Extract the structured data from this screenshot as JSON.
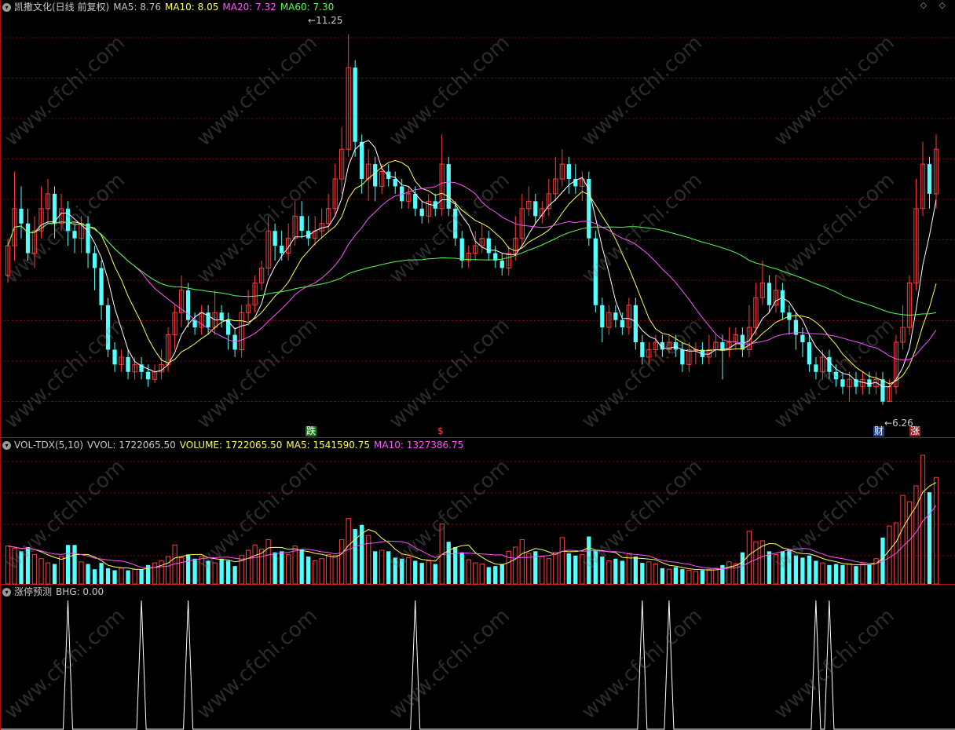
{
  "header": {
    "title": "凯撒文化(日线 前复权)",
    "ma5": "MA5: 8.76",
    "ma10": "MA10: 8.05",
    "ma20": "MA20: 7.32",
    "ma60": "MA60: 7.30",
    "corner_icons": "◇ ◇"
  },
  "colors": {
    "up": "#ff3c3c",
    "down": "#54ffff",
    "ma5": "#ffffff",
    "ma10": "#ffff54",
    "ma20": "#ff54ff",
    "ma60": "#54ff54",
    "grid": "#8b0000"
  },
  "annotations": {
    "high": "11.25",
    "low": "6.26",
    "tag_die": "跌",
    "tag_s": "$",
    "tag_cai": "财",
    "tag_zhang": "涨"
  },
  "volume_header": {
    "name": "VOL-TDX(5,10)",
    "vvol": "VVOL: 1722065.50",
    "volume": "VOLUME: 1722065.50",
    "ma5": "MA5: 1541590.75",
    "ma10": "MA10: 1327386.75"
  },
  "indicator_header": {
    "name": "涨停预测",
    "bhg": "BHG: 0.00"
  },
  "watermark": "www.cfchi.com",
  "chart_data": [
    {
      "type": "candlestick",
      "title": "凯撒文化(日线 前复权)",
      "high_label": 11.25,
      "low_label": 6.26,
      "last_ma": {
        "MA5": 8.76,
        "MA10": 8.05,
        "MA20": 7.32,
        "MA60": 7.3
      },
      "candles": [
        [
          8.0,
          8.4,
          8.5,
          7.9
        ],
        [
          8.4,
          8.9,
          9.4,
          8.2
        ],
        [
          8.9,
          8.7,
          9.2,
          8.5
        ],
        [
          8.7,
          8.3,
          8.9,
          8.2
        ],
        [
          8.3,
          8.6,
          8.8,
          8.1
        ],
        [
          8.6,
          8.9,
          9.2,
          8.5
        ],
        [
          8.9,
          9.1,
          9.3,
          8.7
        ],
        [
          9.1,
          8.7,
          9.2,
          8.5
        ],
        [
          8.7,
          8.9,
          9.1,
          8.6
        ],
        [
          8.9,
          8.6,
          9.0,
          8.4
        ],
        [
          8.6,
          8.5,
          8.7,
          8.3
        ],
        [
          8.5,
          8.7,
          8.8,
          8.3
        ],
        [
          8.7,
          8.3,
          8.8,
          8.1
        ],
        [
          8.3,
          8.1,
          8.4,
          7.8
        ],
        [
          8.1,
          7.6,
          8.2,
          7.4
        ],
        [
          7.6,
          7.0,
          7.7,
          6.9
        ],
        [
          7.0,
          6.8,
          7.1,
          6.7
        ],
        [
          6.8,
          6.9,
          7.0,
          6.7
        ],
        [
          6.9,
          6.7,
          7.0,
          6.6
        ],
        [
          6.7,
          6.8,
          6.9,
          6.6
        ],
        [
          6.8,
          6.7,
          6.9,
          6.6
        ],
        [
          6.7,
          6.6,
          6.8,
          6.5
        ],
        [
          6.6,
          6.7,
          6.8,
          6.55
        ],
        [
          6.7,
          6.8,
          7.0,
          6.6
        ],
        [
          6.8,
          7.2,
          7.3,
          6.7
        ],
        [
          7.2,
          7.5,
          7.6,
          7.0
        ],
        [
          7.5,
          7.8,
          8.0,
          7.3
        ],
        [
          7.8,
          7.4,
          7.9,
          7.3
        ],
        [
          7.4,
          7.3,
          7.5,
          7.2
        ],
        [
          7.3,
          7.5,
          7.6,
          7.2
        ],
        [
          7.5,
          7.3,
          7.6,
          7.2
        ],
        [
          7.3,
          7.5,
          7.8,
          7.2
        ],
        [
          7.5,
          7.4,
          7.6,
          7.3
        ],
        [
          7.4,
          7.2,
          7.5,
          7.0
        ],
        [
          7.2,
          7.0,
          7.3,
          6.9
        ],
        [
          7.0,
          7.5,
          7.6,
          6.9
        ],
        [
          7.5,
          7.6,
          7.8,
          7.4
        ],
        [
          7.6,
          7.9,
          8.0,
          7.5
        ],
        [
          7.9,
          8.1,
          8.2,
          7.8
        ],
        [
          8.1,
          8.6,
          8.8,
          8.0
        ],
        [
          8.6,
          8.4,
          8.7,
          8.2
        ],
        [
          8.4,
          8.3,
          8.6,
          8.2
        ],
        [
          8.3,
          8.5,
          8.7,
          8.2
        ],
        [
          8.5,
          8.8,
          9.0,
          8.4
        ],
        [
          8.8,
          8.6,
          9.0,
          8.5
        ],
        [
          8.6,
          8.5,
          8.8,
          8.4
        ],
        [
          8.5,
          8.6,
          8.8,
          8.4
        ],
        [
          8.6,
          8.7,
          8.9,
          8.5
        ],
        [
          8.7,
          8.9,
          9.1,
          8.6
        ],
        [
          8.9,
          9.3,
          9.5,
          8.8
        ],
        [
          9.3,
          9.7,
          10.0,
          9.1
        ],
        [
          9.7,
          10.8,
          11.25,
          9.6
        ],
        [
          10.8,
          9.8,
          10.9,
          9.6
        ],
        [
          9.8,
          9.3,
          9.9,
          9.1
        ],
        [
          9.3,
          9.5,
          9.7,
          9.0
        ],
        [
          9.5,
          9.2,
          9.6,
          9.0
        ],
        [
          9.2,
          9.4,
          9.5,
          9.1
        ],
        [
          9.4,
          9.3,
          9.5,
          9.2
        ],
        [
          9.3,
          9.2,
          9.4,
          9.1
        ],
        [
          9.2,
          9.0,
          9.3,
          8.9
        ],
        [
          9.0,
          9.1,
          9.2,
          8.9
        ],
        [
          9.1,
          8.9,
          9.2,
          8.8
        ],
        [
          8.9,
          8.8,
          9.0,
          8.7
        ],
        [
          8.8,
          9.0,
          9.1,
          8.7
        ],
        [
          9.0,
          8.9,
          9.1,
          8.8
        ],
        [
          8.9,
          9.5,
          9.9,
          8.8
        ],
        [
          9.5,
          8.9,
          9.6,
          8.8
        ],
        [
          8.9,
          8.5,
          9.0,
          8.4
        ],
        [
          8.5,
          8.2,
          8.6,
          8.1
        ],
        [
          8.2,
          8.3,
          8.4,
          8.1
        ],
        [
          8.3,
          8.4,
          8.6,
          8.2
        ],
        [
          8.4,
          8.5,
          8.7,
          8.3
        ],
        [
          8.5,
          8.3,
          8.6,
          8.2
        ],
        [
          8.3,
          8.2,
          8.4,
          8.1
        ],
        [
          8.2,
          8.1,
          8.3,
          8.0
        ],
        [
          8.1,
          8.3,
          8.4,
          8.0
        ],
        [
          8.3,
          8.5,
          8.8,
          8.2
        ],
        [
          8.5,
          8.9,
          9.1,
          8.4
        ],
        [
          8.9,
          9.0,
          9.2,
          8.8
        ],
        [
          9.0,
          8.8,
          9.1,
          8.7
        ],
        [
          8.8,
          8.9,
          9.0,
          8.7
        ],
        [
          8.9,
          9.1,
          9.3,
          8.8
        ],
        [
          9.1,
          9.3,
          9.6,
          9.0
        ],
        [
          9.3,
          9.5,
          9.7,
          9.2
        ],
        [
          9.5,
          9.3,
          9.6,
          9.1
        ],
        [
          9.3,
          9.2,
          9.5,
          9.1
        ],
        [
          9.2,
          9.3,
          9.4,
          9.0
        ],
        [
          9.3,
          8.5,
          9.4,
          8.4
        ],
        [
          8.5,
          7.6,
          8.6,
          7.5
        ],
        [
          7.6,
          7.3,
          7.7,
          7.1
        ],
        [
          7.3,
          7.5,
          7.6,
          7.2
        ],
        [
          7.5,
          7.4,
          7.6,
          7.3
        ],
        [
          7.4,
          7.3,
          7.5,
          7.2
        ],
        [
          7.3,
          7.6,
          7.7,
          7.2
        ],
        [
          7.6,
          7.1,
          7.7,
          7.0
        ],
        [
          7.1,
          6.9,
          7.2,
          6.8
        ],
        [
          6.9,
          7.0,
          7.1,
          6.8
        ],
        [
          7.0,
          7.1,
          7.2,
          6.9
        ],
        [
          7.1,
          7.0,
          7.2,
          6.9
        ],
        [
          7.0,
          7.1,
          7.2,
          6.95
        ],
        [
          7.1,
          7.0,
          7.2,
          6.9
        ],
        [
          7.0,
          6.8,
          7.1,
          6.7
        ],
        [
          6.8,
          7.0,
          7.1,
          6.7
        ],
        [
          7.0,
          7.0,
          7.1,
          6.8
        ],
        [
          7.0,
          6.9,
          7.1,
          6.8
        ],
        [
          6.9,
          7.0,
          7.2,
          6.8
        ],
        [
          7.0,
          7.1,
          7.2,
          6.9
        ],
        [
          7.1,
          7.0,
          7.2,
          6.6
        ],
        [
          7.0,
          7.1,
          7.3,
          6.9
        ],
        [
          7.1,
          7.2,
          7.3,
          7.0
        ],
        [
          7.2,
          7.0,
          7.3,
          6.9
        ],
        [
          7.0,
          7.3,
          7.6,
          6.9
        ],
        [
          7.3,
          7.7,
          7.9,
          7.2
        ],
        [
          7.7,
          7.9,
          8.2,
          7.6
        ],
        [
          7.9,
          7.6,
          8.0,
          7.5
        ],
        [
          7.6,
          7.8,
          8.0,
          7.5
        ],
        [
          7.8,
          7.5,
          7.9,
          7.4
        ],
        [
          7.5,
          7.4,
          7.6,
          7.2
        ],
        [
          7.4,
          7.2,
          7.5,
          7.0
        ],
        [
          7.2,
          7.1,
          7.3,
          6.9
        ],
        [
          7.1,
          6.8,
          7.2,
          6.7
        ],
        [
          6.8,
          6.7,
          6.9,
          6.6
        ],
        [
          6.7,
          6.9,
          7.0,
          6.6
        ],
        [
          6.9,
          6.7,
          7.0,
          6.6
        ],
        [
          6.7,
          6.6,
          6.8,
          6.5
        ],
        [
          6.6,
          6.5,
          6.7,
          6.4
        ],
        [
          6.5,
          6.6,
          6.7,
          6.3
        ],
        [
          6.6,
          6.5,
          6.7,
          6.4
        ],
        [
          6.5,
          6.6,
          6.7,
          6.4
        ],
        [
          6.6,
          6.5,
          6.7,
          6.4
        ],
        [
          6.5,
          6.6,
          6.7,
          6.4
        ],
        [
          6.6,
          6.3,
          6.7,
          6.26
        ],
        [
          6.3,
          6.5,
          6.6,
          6.3
        ],
        [
          6.5,
          7.1,
          7.2,
          6.4
        ],
        [
          7.1,
          7.3,
          7.6,
          7.0
        ],
        [
          7.3,
          7.9,
          8.0,
          7.2
        ],
        [
          7.9,
          8.9,
          9.3,
          7.8
        ],
        [
          8.9,
          9.5,
          9.8,
          8.8
        ],
        [
          9.5,
          9.1,
          9.6,
          8.9
        ],
        [
          9.1,
          9.7,
          9.9,
          8.9
        ]
      ],
      "volume": [
        36,
        34,
        31,
        35,
        28,
        24,
        20,
        19,
        26,
        37,
        37,
        21,
        19,
        14,
        20,
        15,
        13,
        15,
        13,
        14,
        14,
        18,
        20,
        22,
        26,
        37,
        25,
        28,
        24,
        26,
        22,
        20,
        24,
        22,
        17,
        27,
        32,
        37,
        33,
        42,
        30,
        31,
        28,
        36,
        33,
        26,
        22,
        24,
        28,
        27,
        42,
        62,
        52,
        56,
        46,
        31,
        32,
        31,
        25,
        24,
        25,
        22,
        20,
        22,
        19,
        57,
        40,
        35,
        30,
        23,
        20,
        19,
        16,
        17,
        19,
        31,
        35,
        42,
        29,
        31,
        26,
        24,
        30,
        44,
        29,
        27,
        28,
        45,
        32,
        26,
        22,
        24,
        22,
        29,
        26,
        20,
        21,
        19,
        15,
        14,
        16,
        14,
        13,
        12,
        13,
        14,
        15,
        18,
        21,
        19,
        30,
        50,
        40,
        41,
        31,
        28,
        31,
        33,
        27,
        25,
        27,
        22,
        20,
        18,
        19,
        18,
        19,
        17,
        19,
        18,
        24,
        44,
        55,
        58,
        84,
        78,
        93,
        122,
        87,
        101
      ],
      "volume_ma": {
        "MA5": 1541590.75,
        "MA10": 1327386.75,
        "last_volume": 1722065.5
      }
    },
    {
      "type": "line",
      "title": "涨停预测",
      "value": "BHG: 0.00",
      "signal_x": [
        9,
        20,
        27,
        61,
        95,
        99,
        121,
        123
      ]
    }
  ]
}
